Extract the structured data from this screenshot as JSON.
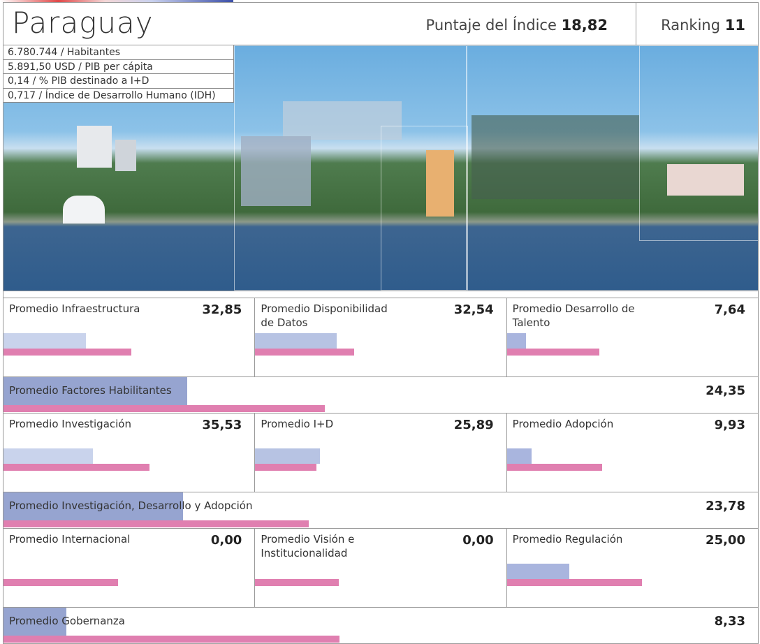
{
  "header": {
    "country": "Paraguay",
    "score_label": "Puntaje del Índice",
    "score": "18,82",
    "ranking_label": "Ranking",
    "ranking": "11"
  },
  "stats": [
    "6.780.744 / Habitantes",
    "5.891,50 USD / PIB per cápita",
    "0,14 / % PIB destinado a I+D",
    "0,717 / Índice de Desarrollo Humano (IDH)"
  ],
  "colors": {
    "country_bar": "#b7c3e3",
    "factor_bar": "#96a4d0",
    "reference_bar": "#e07fb0"
  },
  "sections": [
    {
      "cells": [
        {
          "label": "Promedio Infraestructura",
          "value": "32,85",
          "pct": 32.85,
          "ref_pct": 51,
          "color": "#c9d3ec"
        },
        {
          "label": "Promedio Disponibilidad de Datos",
          "value": "32,54",
          "pct": 32.54,
          "ref_pct": 39.5,
          "color": "#b7c3e3"
        },
        {
          "label": "Promedio Desarrollo de Talento",
          "value": "7,64",
          "pct": 7.64,
          "ref_pct": 36.7,
          "color": "#a9b5de"
        }
      ],
      "factor": {
        "label": "Promedio Factores Habilitantes",
        "value": "24,35",
        "pct": 24.35,
        "ref_pct": 42.6
      }
    },
    {
      "cells": [
        {
          "label": "Promedio Investigación",
          "value": "35,53",
          "pct": 35.53,
          "ref_pct": 58.3,
          "color": "#c9d3ec"
        },
        {
          "label": "Promedio I+D",
          "value": "25,89",
          "pct": 25.89,
          "ref_pct": 24.4,
          "color": "#b7c3e3"
        },
        {
          "label": "Promedio Adopción",
          "value": "9,93",
          "pct": 9.93,
          "ref_pct": 38,
          "color": "#a9b5de"
        }
      ],
      "factor": {
        "label": "Promedio Investigación, Desarrollo y Adopción",
        "value": "23,78",
        "pct": 23.78,
        "ref_pct": 40.5
      }
    },
    {
      "cells": [
        {
          "label": "Promedio Internacional",
          "value": "0,00",
          "pct": 0,
          "ref_pct": 45.6,
          "color": "#c9d3ec"
        },
        {
          "label": "Promedio Visión e Institucionalidad",
          "value": "0,00",
          "pct": 0,
          "ref_pct": 33.3,
          "color": "#b7c3e3"
        },
        {
          "label": "Promedio Regulación",
          "value": "25,00",
          "pct": 25,
          "ref_pct": 53.9,
          "color": "#a9b5de"
        }
      ],
      "factor": {
        "label": "Promedio Gobernanza",
        "value": "8,33",
        "pct": 8.33,
        "ref_pct": 44.5
      }
    }
  ]
}
